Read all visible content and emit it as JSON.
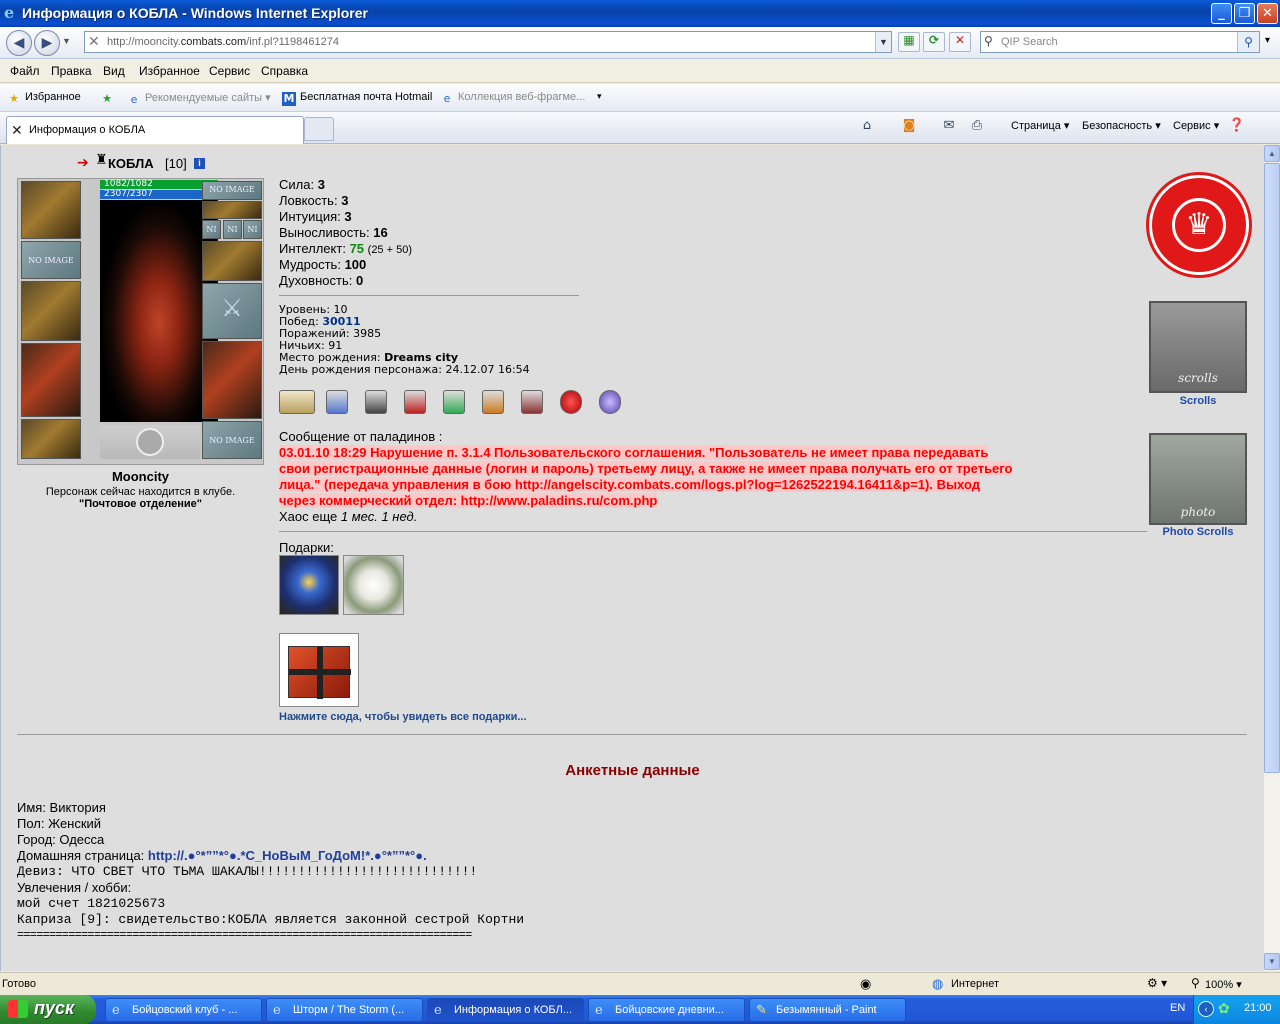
{
  "window": {
    "title": "Информация о КОБЛА - Windows Internet Explorer",
    "url_prefix": "http://mooncity.",
    "url_domain": "combats.com",
    "url_path": "/inf.pl?1198461274",
    "search_placeholder": "QIP Search"
  },
  "menu": [
    "Файл",
    "Правка",
    "Вид",
    "Избранное",
    "Сервис",
    "Справка"
  ],
  "favorites": {
    "label": "Избранное",
    "items": [
      "Рекомендуемые сайты",
      "Бесплатная почта Hotmail",
      "Коллекция веб-фрагме..."
    ]
  },
  "tab": {
    "title": "Информация о КОБЛА"
  },
  "commands": [
    "Страница",
    "Безопасность",
    "Сервис"
  ],
  "character": {
    "name": "КОБЛА",
    "level_tag": "[10]",
    "hp": "1082/1082",
    "mana": "2307/2307",
    "no_image": "NO IMAGE",
    "ni": "NI",
    "city": "Mooncity",
    "location_text": "Персонаж сейчас находится в клубе.",
    "location_name": "\"Почтовое отделение\""
  },
  "stats": [
    {
      "label": "Сила:",
      "value": "3"
    },
    {
      "label": "Ловкость:",
      "value": "3"
    },
    {
      "label": "Интуиция:",
      "value": "3"
    },
    {
      "label": "Выносливость:",
      "value": "16"
    },
    {
      "label": "Интеллект:",
      "value": "75",
      "extra": "(25 + 50)"
    },
    {
      "label": "Мудрость:",
      "value": "100"
    },
    {
      "label": "Духовность:",
      "value": "0"
    }
  ],
  "info": {
    "level": "Уровень: 10",
    "wins_label": "Побед:",
    "wins": "30011",
    "losses": "Поражений: 3985",
    "draws": "Ничьих: 91",
    "birthplace_label": "Место рождения:",
    "birthplace": "Dreams city",
    "birthday": "День рождения персонажа: 24.12.07 16:54"
  },
  "paladins": {
    "label": "Сообщение от паладинов :",
    "lines": [
      "03.01.10 18:29 Нарушение п. 3.1.4 Пользовательского соглашения. \"Пользователь не имеет права передавать",
      "свои регистрационные данные (логин и пароль) третьему лицу, а также не имеет права получать его от третьего",
      "лица.\" (передача управления в бою http://angelscity.combats.com/logs.pl?log=1262522194.16411&p=1). Выход",
      "через коммерческий отдел: http://www.paladins.ru/com.php"
    ],
    "chaos_label": "Хаос еще",
    "chaos_value": "1 мес. 1 нед."
  },
  "gifts": {
    "label": "Подарки:",
    "more": "Нажмите сюда, чтобы увидеть все подарки..."
  },
  "side": {
    "scrolls": "Scrolls",
    "scrolls_img": "scrolls",
    "photo": "Photo Scrolls",
    "photo_img": "photo"
  },
  "profile": {
    "heading": "Анкетные данные",
    "name": "Имя: Виктория",
    "gender": "Пол: Женский",
    "city": "Город: Одесса",
    "homepage_label": "Домашняя страница:",
    "homepage": "http://.●°*””*°●.*С_НоВыМ_ГоДоМ!*.●°*””*°●.",
    "motto": "Девиз: ЧТО СВЕТ ЧТО ТЬМА ШАКАЛЫ!!!!!!!!!!!!!!!!!!!!!!!!!!!!",
    "hobby": "Увлечения / хобби:",
    "hobby1": "мой счет   1821025673",
    "hobby2": "Каприза [9]: свидетельство:КОБЛА является законной сестрой Кортни",
    "hobby3": "======================================================================="
  },
  "status": {
    "text": "Готово",
    "zone": "Интернет",
    "zoom": "100%"
  },
  "taskbar": {
    "start": "пуск",
    "tasks": [
      "Бойцовский клуб - ...",
      "Шторм / The Storm (...",
      "Информация о КОБЛ...",
      "Бойцовские дневни...",
      "Безымянный - Paint"
    ],
    "lang": "EN",
    "time": "21:00"
  }
}
